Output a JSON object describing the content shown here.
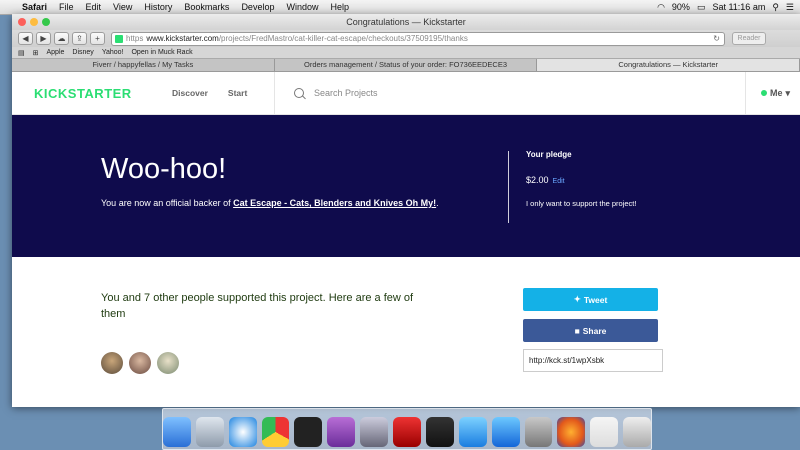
{
  "menubar": {
    "items": [
      "Safari",
      "File",
      "Edit",
      "View",
      "History",
      "Bookmarks",
      "Develop",
      "Window",
      "Help"
    ],
    "battery": "90%",
    "clock": "Sat 11:16 am"
  },
  "window": {
    "title": "Congratulations — Kickstarter"
  },
  "toolbar": {
    "url_scheme": "https",
    "url_domain": "www.kickstarter.com",
    "url_path": "/projects/FredMastro/cat-killer-cat-escape/checkouts/37509195/thanks",
    "reader_label": "Reader"
  },
  "bookmarks": [
    "Apple",
    "Disney",
    "Yahoo!",
    "Open in Muck Rack"
  ],
  "tabs": [
    "Fiverr / happyfellas / My Tasks",
    "Orders management / Status of your order: FO736EEDECE3",
    "Congratulations — Kickstarter"
  ],
  "ks": {
    "logo": "KICKSTARTER",
    "nav_discover": "Discover",
    "nav_start": "Start",
    "search_placeholder": "Search Projects",
    "me": "Me"
  },
  "hero": {
    "heading": "Woo-hoo!",
    "backer_prefix": "You are now an official backer of ",
    "project_link": "Cat Escape - Cats, Blenders and Knives Oh My!",
    "backer_suffix": ".",
    "pledge_label": "Your pledge",
    "pledge_amount": "$2.00",
    "edit_label": "Edit",
    "pledge_note": "I only want to support the project!"
  },
  "support": {
    "text": "You and 7 other people supported this project. Here are a few of them",
    "tweet": "Tweet",
    "share": "Share",
    "short_url": "http://kck.st/1wpXsbk"
  },
  "colors": {
    "kickstarter_green": "#2bde73",
    "hero_bg": "#0f0b4c",
    "tweet": "#14b1e7",
    "facebook": "#3b5998"
  }
}
